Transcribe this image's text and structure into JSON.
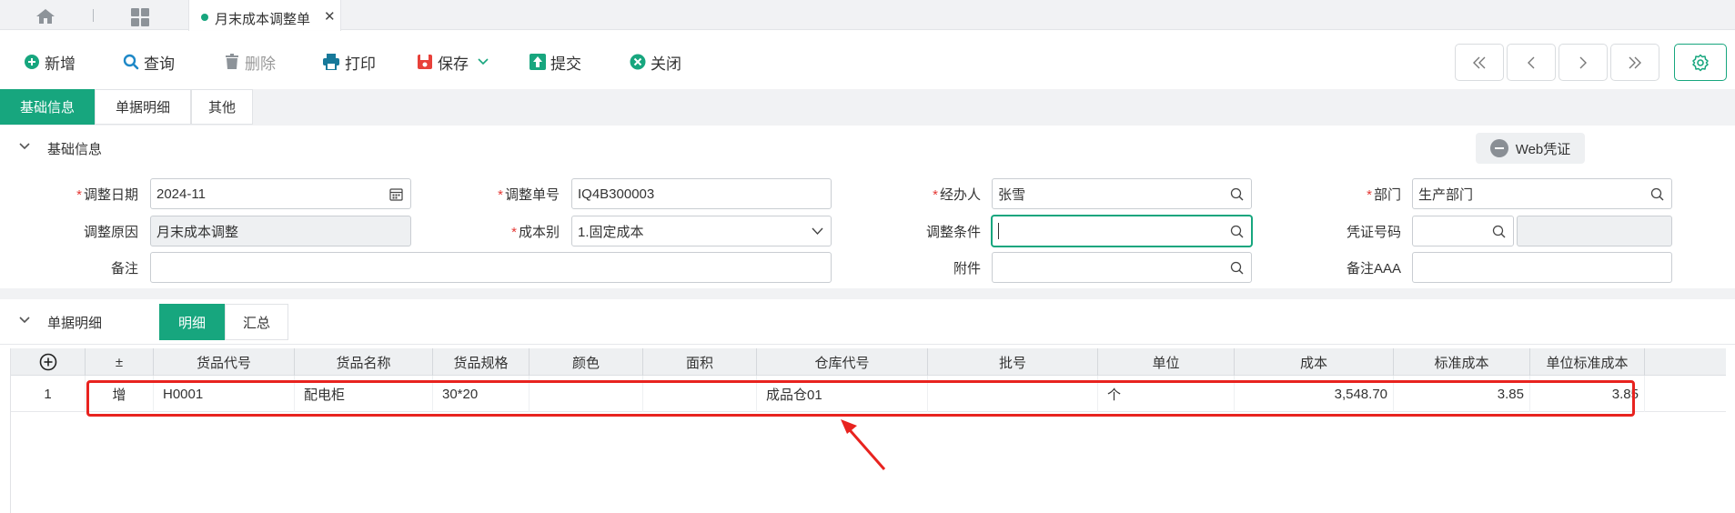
{
  "tabstrip": {
    "home_icon": "home-icon",
    "apps_icon": "grid-icon",
    "active_tab": {
      "label": "月末成本调整单",
      "close": "✕"
    }
  },
  "toolbar": {
    "new": "新增",
    "query": "查询",
    "delete": "删除",
    "print": "打印",
    "save": "保存",
    "submit": "提交",
    "close": "关闭"
  },
  "section_tabs": [
    "基础信息",
    "单据明细",
    "其他"
  ],
  "basic": {
    "title": "基础信息",
    "web_voucher": "Web凭证",
    "fields": {
      "adjust_date": {
        "label": "调整日期",
        "value": "2024-11"
      },
      "adjust_no": {
        "label": "调整单号",
        "value": "IQ4B300003"
      },
      "handler": {
        "label": "经办人",
        "value": "张雪"
      },
      "department": {
        "label": "部门",
        "value": "生产部门"
      },
      "reason": {
        "label": "调整原因",
        "value": "月末成本调整"
      },
      "cost_type": {
        "label": "成本别",
        "value": "1.固定成本"
      },
      "condition": {
        "label": "调整条件",
        "value": ""
      },
      "voucher_no": {
        "label": "凭证号码",
        "value": ""
      },
      "remark": {
        "label": "备注",
        "value": ""
      },
      "attachment": {
        "label": "附件",
        "value": ""
      },
      "remark_aaa": {
        "label": "备注AAA",
        "value": ""
      }
    }
  },
  "detail": {
    "title": "单据明细",
    "subtabs": [
      "明细",
      "汇总"
    ],
    "columns": [
      "±",
      "货品代号",
      "货品名称",
      "货品规格",
      "颜色",
      "面积",
      "仓库代号",
      "批号",
      "单位",
      "成本",
      "标准成本",
      "单位标准成本"
    ],
    "rows": [
      {
        "no": "1",
        "op": "增",
        "code": "H0001",
        "name": "配电柜",
        "spec": "30*20",
        "color": "",
        "area": "",
        "warehouse": "成品仓01",
        "batch": "",
        "unit": "个",
        "cost": "3,548.70",
        "std_cost": "3.85",
        "unit_std_cost": "3.85"
      }
    ]
  },
  "colors": {
    "accent": "#17a67e",
    "highlight": "#e8231f"
  }
}
